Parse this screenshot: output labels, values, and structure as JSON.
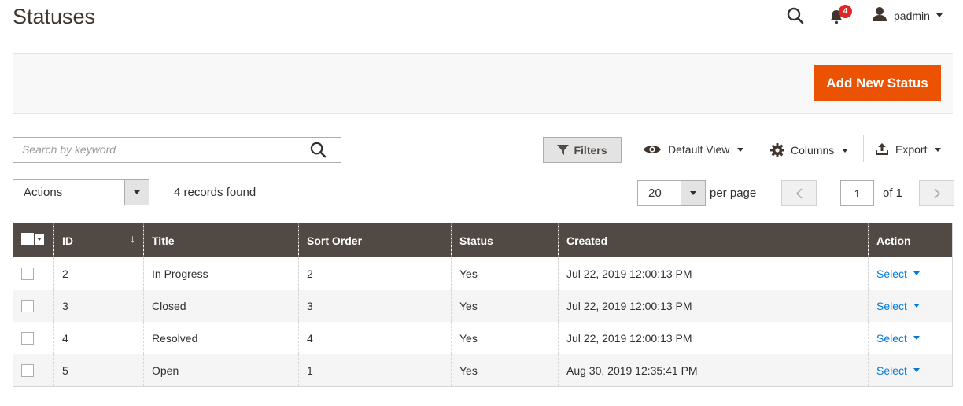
{
  "header": {
    "title": "Statuses",
    "notifications_count": "4",
    "user_name": "padmin"
  },
  "action_bar": {
    "add_button": "Add New Status"
  },
  "toolbar": {
    "search_placeholder": "Search by keyword",
    "filters_label": "Filters",
    "view_label": "Default View",
    "columns_label": "Columns",
    "export_label": "Export"
  },
  "list_controls": {
    "actions_label": "Actions",
    "records_found": "4 records found",
    "per_page_value": "20",
    "per_page_label": "per page",
    "current_page": "1",
    "total_pages_label": "of 1"
  },
  "grid": {
    "columns": [
      "ID",
      "Title",
      "Sort Order",
      "Status",
      "Created",
      "Action"
    ],
    "rows": [
      {
        "id": "2",
        "title": "In Progress",
        "sort_order": "2",
        "status": "Yes",
        "created": "Jul 22, 2019 12:00:13 PM",
        "action": "Select"
      },
      {
        "id": "3",
        "title": "Closed",
        "sort_order": "3",
        "status": "Yes",
        "created": "Jul 22, 2019 12:00:13 PM",
        "action": "Select"
      },
      {
        "id": "4",
        "title": "Resolved",
        "sort_order": "4",
        "status": "Yes",
        "created": "Jul 22, 2019 12:00:13 PM",
        "action": "Select"
      },
      {
        "id": "5",
        "title": "Open",
        "sort_order": "1",
        "status": "Yes",
        "created": "Aug 30, 2019 12:35:41 PM",
        "action": "Select"
      }
    ]
  },
  "icons": {
    "search": "search-icon",
    "bell": "bell-icon",
    "user": "user-icon",
    "filter": "funnel-icon",
    "view": "eye-icon",
    "columns": "gear-icon",
    "export": "export-icon",
    "sort": "arrow-down-icon"
  },
  "colors": {
    "accent": "#eb5202",
    "grid_header": "#514943",
    "link": "#007bdb",
    "badge": "#e22626"
  }
}
